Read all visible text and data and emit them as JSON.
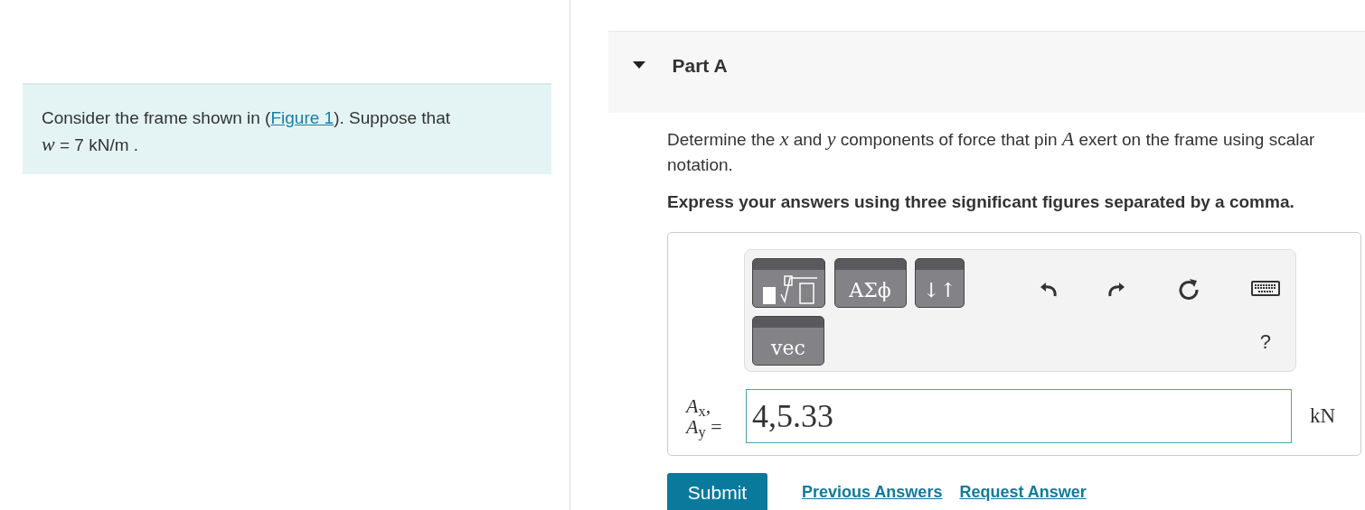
{
  "intro": {
    "before": "Consider the frame shown in (",
    "link": "Figure 1",
    "after": "). Suppose that",
    "formula": "*w* = 7  kN/m ."
  },
  "part": {
    "title": "Part A",
    "expanded": true
  },
  "question": "Determine the *x* and *y* components of force that pin *A* exert on the frame using scalar notation.",
  "instruction": "Express your answers using three significant figures separated by a comma.",
  "toolbar": {
    "buttons": [
      {
        "kind": "templates"
      },
      {
        "kind": "text",
        "label": "ΑΣϕ"
      },
      {
        "kind": "text",
        "label": "↓↑"
      },
      {
        "kind": "text",
        "label": "vec"
      }
    ],
    "actions": [
      {
        "kind": "undo"
      },
      {
        "kind": "redo"
      },
      {
        "kind": "reset"
      },
      {
        "kind": "keyboard"
      }
    ],
    "help": "?"
  },
  "answer": {
    "label_lines": [
      "*A*$_{x}$,",
      "*A*$_{y}$ ="
    ],
    "value": "4,5.33",
    "unit": "kN"
  },
  "buttons": {
    "submit": "Submit",
    "links": [
      "Previous Answers",
      "Request Answer"
    ]
  }
}
